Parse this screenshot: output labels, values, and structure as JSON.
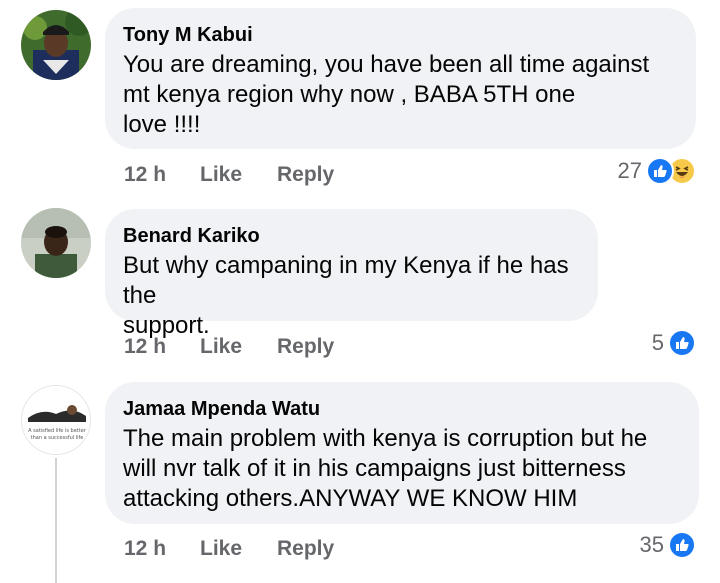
{
  "comments": [
    {
      "author": "Tony M Kabui",
      "lines": [
        "You are dreaming, you have been all time against",
        "mt kenya region why now ,  BABA 5TH   one",
        "love !!!!"
      ],
      "time": "12 h",
      "like_label": "Like",
      "reply_label": "Reply",
      "reaction_count": "27",
      "reactions": [
        "like-icon",
        "haha-icon"
      ]
    },
    {
      "author": "Benard Kariko",
      "lines": [
        "But why campaning in my Kenya if he has the",
        "support."
      ],
      "time": "12 h",
      "like_label": "Like",
      "reply_label": "Reply",
      "reaction_count": "5",
      "reactions": [
        "like-icon"
      ]
    },
    {
      "author": "Jamaa Mpenda Watu",
      "lines": [
        "The main problem with kenya is corruption  but he",
        "will nvr talk of it in his campaigns just bitterness",
        "attacking  others.ANYWAY WE KNOW HIM"
      ],
      "time": "12 h",
      "like_label": "Like",
      "reply_label": "Reply",
      "reaction_count": "35",
      "reactions": [
        "like-icon"
      ],
      "avatar_text": [
        "A satisfied life is better",
        "than a successful life"
      ]
    }
  ],
  "colors": {
    "bubble": "#f0f2f5",
    "meta": "#65676b",
    "like_blue": "#1877f2",
    "haha_yellow": "#f7c94a"
  }
}
